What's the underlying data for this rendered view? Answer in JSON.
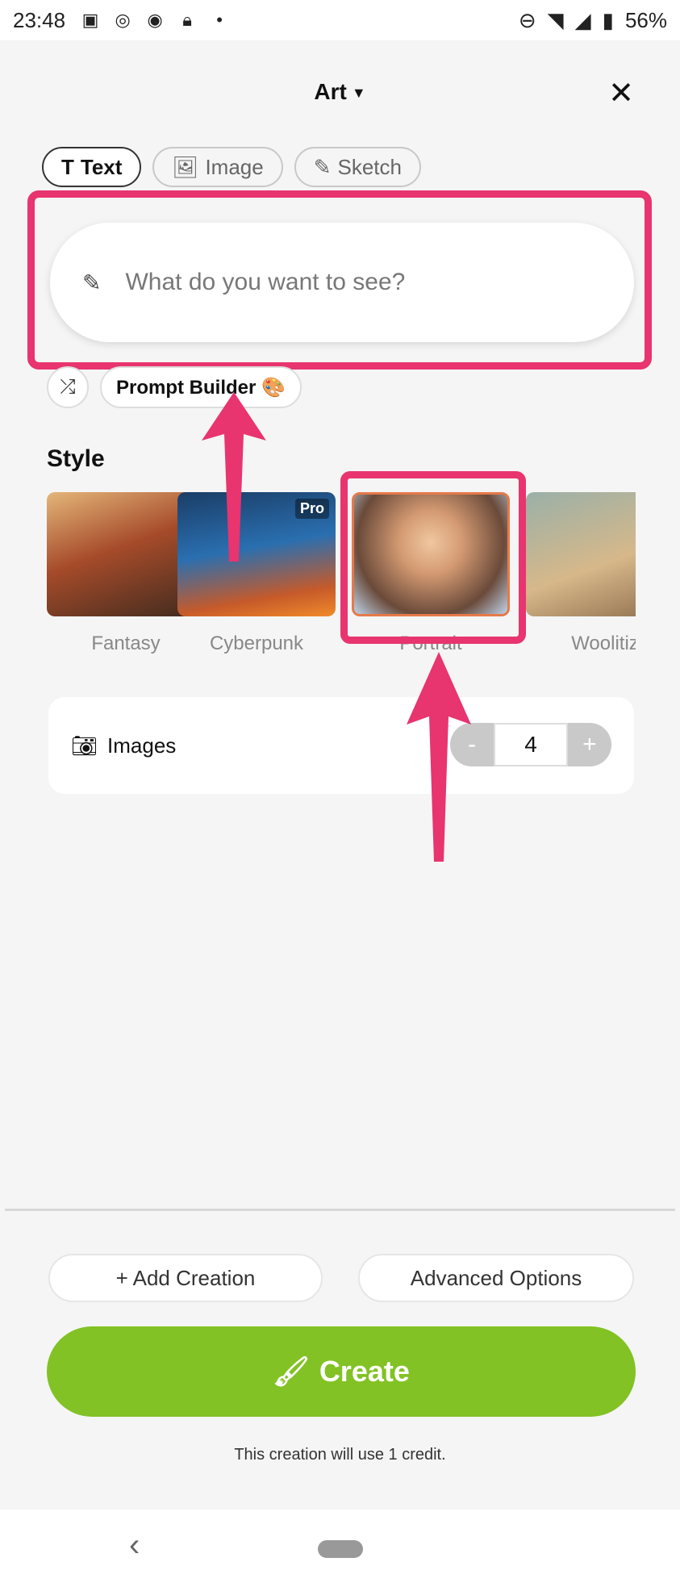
{
  "status_bar": {
    "time": "23:48",
    "battery": "56%"
  },
  "header": {
    "title": "Art",
    "close_icon": "close-icon"
  },
  "tabs": [
    {
      "label": "Text",
      "icon": "text-icon",
      "active": true
    },
    {
      "label": "Image",
      "icon": "image-icon",
      "active": false
    },
    {
      "label": "Sketch",
      "icon": "pencil-icon",
      "active": false
    }
  ],
  "prompt": {
    "placeholder": "What do you want to see?",
    "value": ""
  },
  "tools": {
    "shuffle_icon": "shuffle-icon",
    "prompt_builder_label": "Prompt Builder 🎨"
  },
  "style_section": {
    "title": "Style",
    "items": [
      {
        "label": "Fantasy",
        "pro": false
      },
      {
        "label": "Cyberpunk",
        "pro": true,
        "badge": "Pro"
      },
      {
        "label": "Portrait",
        "pro": false,
        "selected": true
      },
      {
        "label": "Woolitiz",
        "pro": false
      }
    ]
  },
  "images_setting": {
    "label": "Images",
    "minus": "-",
    "value": "4",
    "plus": "+"
  },
  "actions": {
    "add_creation": "+ Add Creation",
    "advanced_options": "Advanced Options",
    "create": "Create",
    "credit_note": "This creation will use 1 credit."
  },
  "colors": {
    "accent_green": "#82c224",
    "annotation_pink": "#e8346f"
  }
}
